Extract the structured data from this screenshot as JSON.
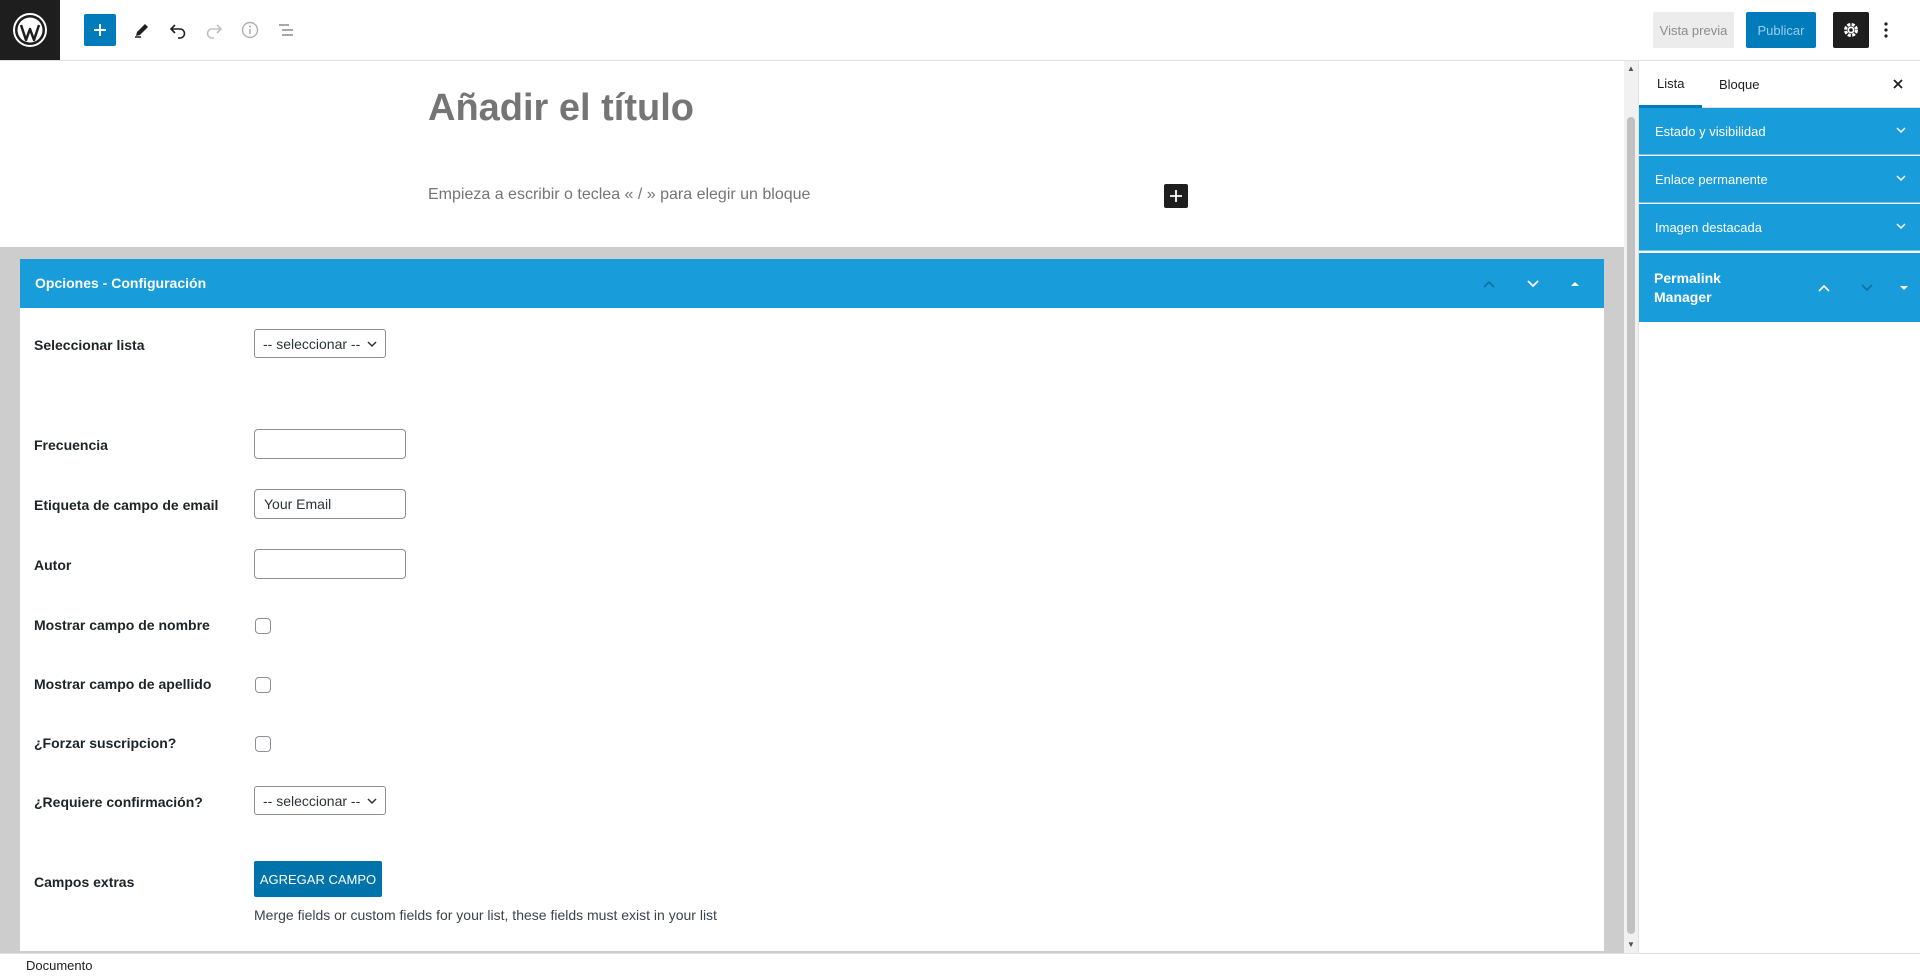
{
  "toolbar": {
    "preview_label": "Vista previa",
    "publish_label": "Publicar",
    "icons": [
      "wordpress-icon",
      "plus-icon",
      "pencil-icon",
      "undo-icon",
      "redo-icon",
      "info-icon",
      "list-view-icon",
      "gear-icon",
      "more-vertical-icon"
    ]
  },
  "editor": {
    "title_placeholder": "Añadir el título",
    "block_placeholder": "Empieza a escribir o teclea « / » para elegir un bloque"
  },
  "metabox": {
    "title": "Opciones - Configuración",
    "fields": {
      "list_label": "Seleccionar lista",
      "list_value": "-- seleccionar --",
      "frequency_label": "Frecuencia",
      "frequency_value": "",
      "email_label": "Etiqueta de campo de email",
      "email_value": "Your Email",
      "author_label": "Autor",
      "author_value": "",
      "show_name_label": "Mostrar campo de nombre",
      "show_lastname_label": "Mostrar campo de apellido",
      "force_label": "¿Forzar suscripcion?",
      "confirm_label": "¿Requiere confirmación?",
      "confirm_value": "-- seleccionar --",
      "extras_label": "Campos extras",
      "add_field_label": "AGREGAR CAMPO",
      "extras_help": "Merge fields or custom fields for your list, these fields must exist in your list"
    }
  },
  "sidebar": {
    "tabs": [
      {
        "label": "Lista",
        "active": true
      },
      {
        "label": "Bloque",
        "active": false
      }
    ],
    "panels": [
      {
        "label": "Estado y visibilidad"
      },
      {
        "label": "Enlace permanente"
      },
      {
        "label": "Imagen destacada"
      }
    ],
    "permalink_manager_title": "Permalink Manager"
  },
  "footer": {
    "breadcrumb": "Documento"
  },
  "colors": {
    "accent": "#007cba",
    "panel_blue": "#189dda",
    "dark": "#1e1e1e"
  }
}
